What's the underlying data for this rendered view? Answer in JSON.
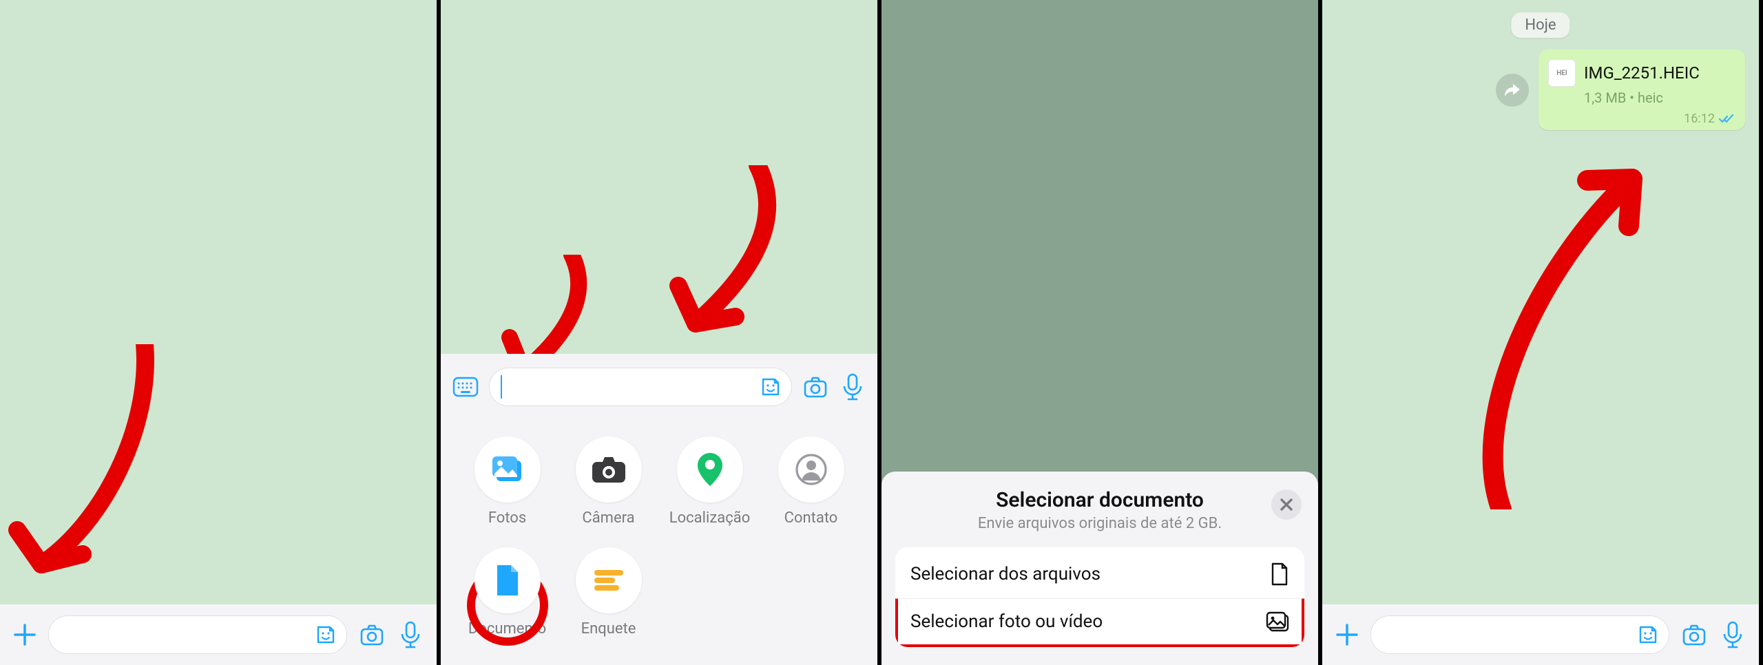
{
  "panel2": {
    "attachments": {
      "photos": "Fotos",
      "camera": "Câmera",
      "location": "Localização",
      "contact": "Contato",
      "document": "Documento",
      "poll": "Enquete"
    }
  },
  "panel3": {
    "sheet_title": "Selecionar documento",
    "sheet_subtitle": "Envie arquivos originais de até 2 GB.",
    "row_files": "Selecionar dos arquivos",
    "row_media": "Selecionar foto ou vídeo"
  },
  "panel4": {
    "date_label": "Hoje",
    "file_name": "IMG_2251.HEIC",
    "file_meta": "1,3 MB • heic",
    "file_badge": "HEI",
    "time": "16:12"
  }
}
